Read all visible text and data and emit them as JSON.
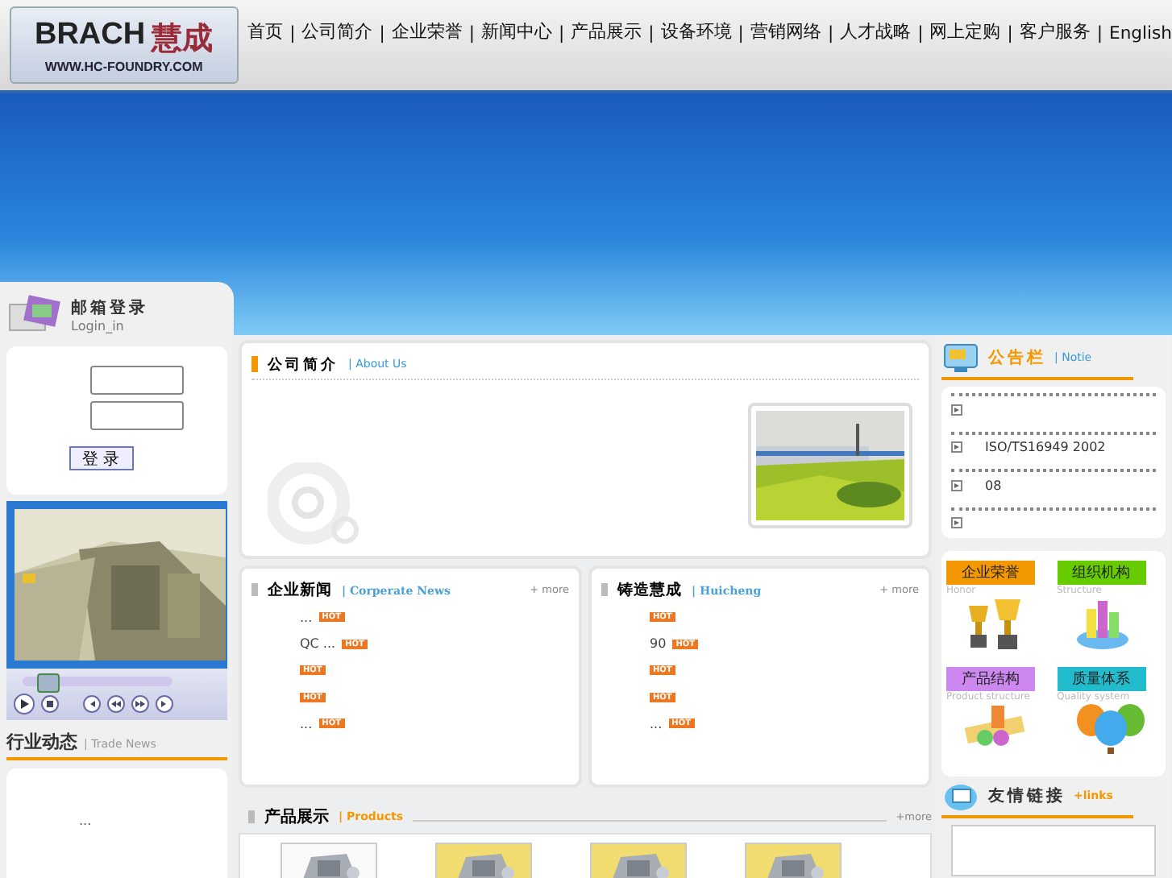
{
  "logo": {
    "brand": "BRACH",
    "brand_cn": "慧成",
    "url": "WWW.HC-FOUNDRY.COM"
  },
  "nav": [
    {
      "label": "首页"
    },
    {
      "label": "公司简介",
      "sep": "|"
    },
    {
      "label": "企业荣誉",
      "sep": "|"
    },
    {
      "label": "新闻中心",
      "sep": "|"
    },
    {
      "label": "产品展示",
      "sep": "|"
    },
    {
      "label": "设备环境",
      "sep": "|"
    },
    {
      "label": "营销网络",
      "sep": "|"
    },
    {
      "label": "人才战略",
      "sep": "|"
    },
    {
      "label": "网上定购",
      "sep": "|"
    },
    {
      "label": "客户服务",
      "sep": "|"
    },
    {
      "label": "English",
      "sep": "|"
    }
  ],
  "login": {
    "title": "邮箱登录",
    "subtitle": "Login_in",
    "button": "登 录"
  },
  "video": {
    "level": 0.1
  },
  "trade_news": {
    "title": "行业动态",
    "subtitle": "| Trade News",
    "items": [
      "..."
    ]
  },
  "about": {
    "title": "公司简介",
    "subtitle": "| About Us"
  },
  "corp_news": {
    "title": "企业新闻",
    "subtitle": "| Corperate News",
    "more": "+ more",
    "items": [
      {
        "text": "...",
        "hot": "HOT"
      },
      {
        "text": "QC   ...",
        "hot": "HOT"
      },
      {
        "hot": "HOT"
      },
      {
        "hot": "HOT"
      },
      {
        "text": "...",
        "hot": "HOT"
      }
    ]
  },
  "huicheng": {
    "title": "铸造慧成",
    "subtitle": "| Huicheng",
    "more": "+ more",
    "items": [
      {
        "hot": "HOT"
      },
      {
        "text": "90",
        "hot": "HOT"
      },
      {
        "hot": "HOT"
      },
      {
        "hot": "HOT"
      },
      {
        "text": "...",
        "hot": "HOT"
      }
    ]
  },
  "products": {
    "title": "产品展示",
    "subtitle": "| Products",
    "more": "+more"
  },
  "notice": {
    "title": "公告栏",
    "subtitle": "| Notie",
    "items": [
      {
        "kind": "blank"
      },
      {
        "kind": "text",
        "text": "ISO/TS16949 2002"
      },
      {
        "kind": "text",
        "text": "08"
      },
      {
        "kind": "blank"
      }
    ]
  },
  "tiles": [
    {
      "label": "企业荣誉",
      "sub": "Honor",
      "color": "#f39800",
      "kind": "trophy"
    },
    {
      "label": "组织机构",
      "sub": "Structure",
      "color": "#66cc00",
      "kind": "bars"
    },
    {
      "label": "产品结构",
      "sub": "Product structure",
      "color": "#cc88ee",
      "kind": "coins"
    },
    {
      "label": "质量体系",
      "sub": "Quality system",
      "color": "#22bbcc",
      "kind": "balloons"
    }
  ],
  "links": {
    "title": "友情链接",
    "subtitle": "+links"
  }
}
